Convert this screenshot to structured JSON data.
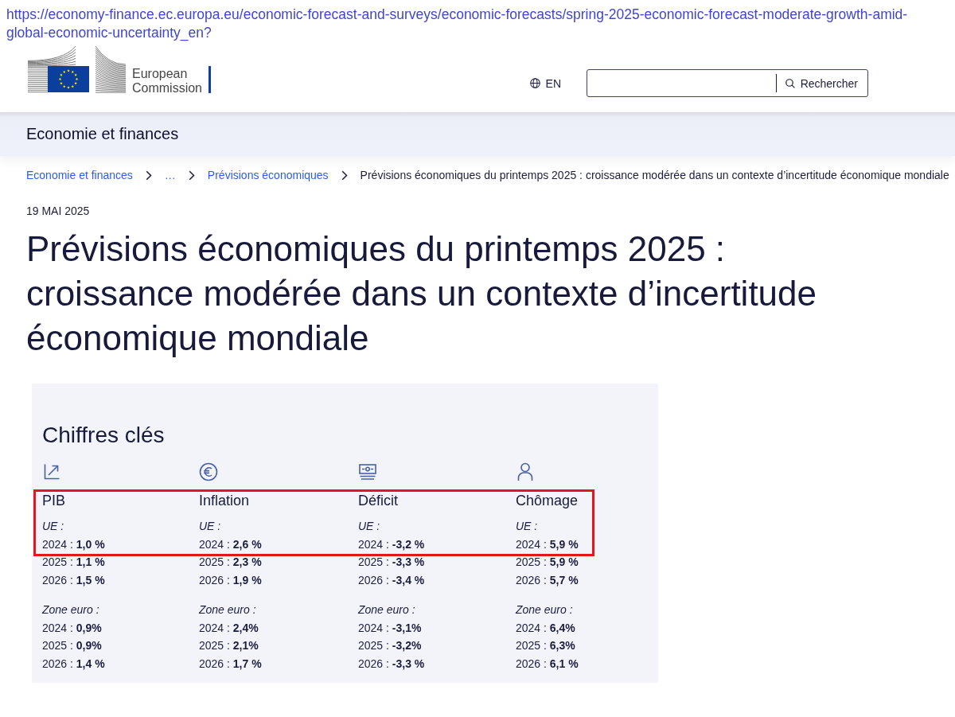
{
  "address_bar": {
    "url": "https://economy-finance.ec.europa.eu/economic-forecast-and-surveys/economic-forecasts/spring-2025-economic-forecast-moderate-growth-amid-global-economic-uncertainty_en?"
  },
  "header": {
    "logo_text": "European Commission",
    "language": "EN",
    "search": {
      "button": "Rechercher"
    }
  },
  "site_band": {
    "title": "Economie et finances"
  },
  "breadcrumb": [
    {
      "label": "Economie et finances",
      "kind": "link"
    },
    {
      "label": "…",
      "kind": "ellipsis"
    },
    {
      "label": "Prévisions économiques",
      "kind": "link"
    },
    {
      "label": "Prévisions économiques du printemps 2025 : croissance modérée dans un contexte d’incertitude économique mondiale",
      "kind": "current"
    }
  ],
  "article": {
    "date": "19 MAI 2025",
    "title": "Prévisions économiques du printemps 2025 : croissance modérée dans un contexte d’incertitude économique mondiale"
  },
  "key_figures": {
    "title": "Chiffres clés",
    "highlighted": true,
    "columns": [
      {
        "title": "PIB",
        "groups": [
          {
            "label": "UE :",
            "rows": [
              "2024 : **1,0 %**",
              "2025 : **1,1 %**",
              "2026 : **1,5 %**"
            ]
          },
          {
            "label": "Zone euro :",
            "rows": [
              "2024 : **0,9%**",
              "2025 : **0,9%**",
              "2026 : **1,4 %**"
            ]
          }
        ]
      },
      {
        "title": "Inflation",
        "groups": [
          {
            "label": "UE :",
            "rows": [
              "2024 : **2,6 %**",
              "2025 : **2,3 %**",
              "2026 : **1,9 %**"
            ]
          },
          {
            "label": "Zone euro :",
            "rows": [
              "2024 : **2,4%**",
              "2025 : **2,1%**",
              "2026 : **1,7 %**"
            ]
          }
        ]
      },
      {
        "title": "Déficit",
        "groups": [
          {
            "label": "UE :",
            "rows": [
              "2024 : **-3,2 %**",
              "2025 : **-3,3 %**",
              "2026 : **-3,4 %**"
            ]
          },
          {
            "label": "Zone euro :",
            "rows": [
              "2024 : **-3,1%**",
              "2025 : **-3,2%**",
              "2026 : **-3,3 %**"
            ]
          }
        ]
      },
      {
        "title": "Chômage",
        "groups": [
          {
            "label": "UE :",
            "rows": [
              "2024 : **5,9 %**",
              "2025 : **5,9 %**",
              "2026 : **5,7 %**"
            ]
          },
          {
            "label": "Zone euro :",
            "rows": [
              "2024 : **6,4%**",
              "2025 : **6,3%**",
              "2026 : **6,1 %**"
            ]
          }
        ]
      }
    ]
  }
}
